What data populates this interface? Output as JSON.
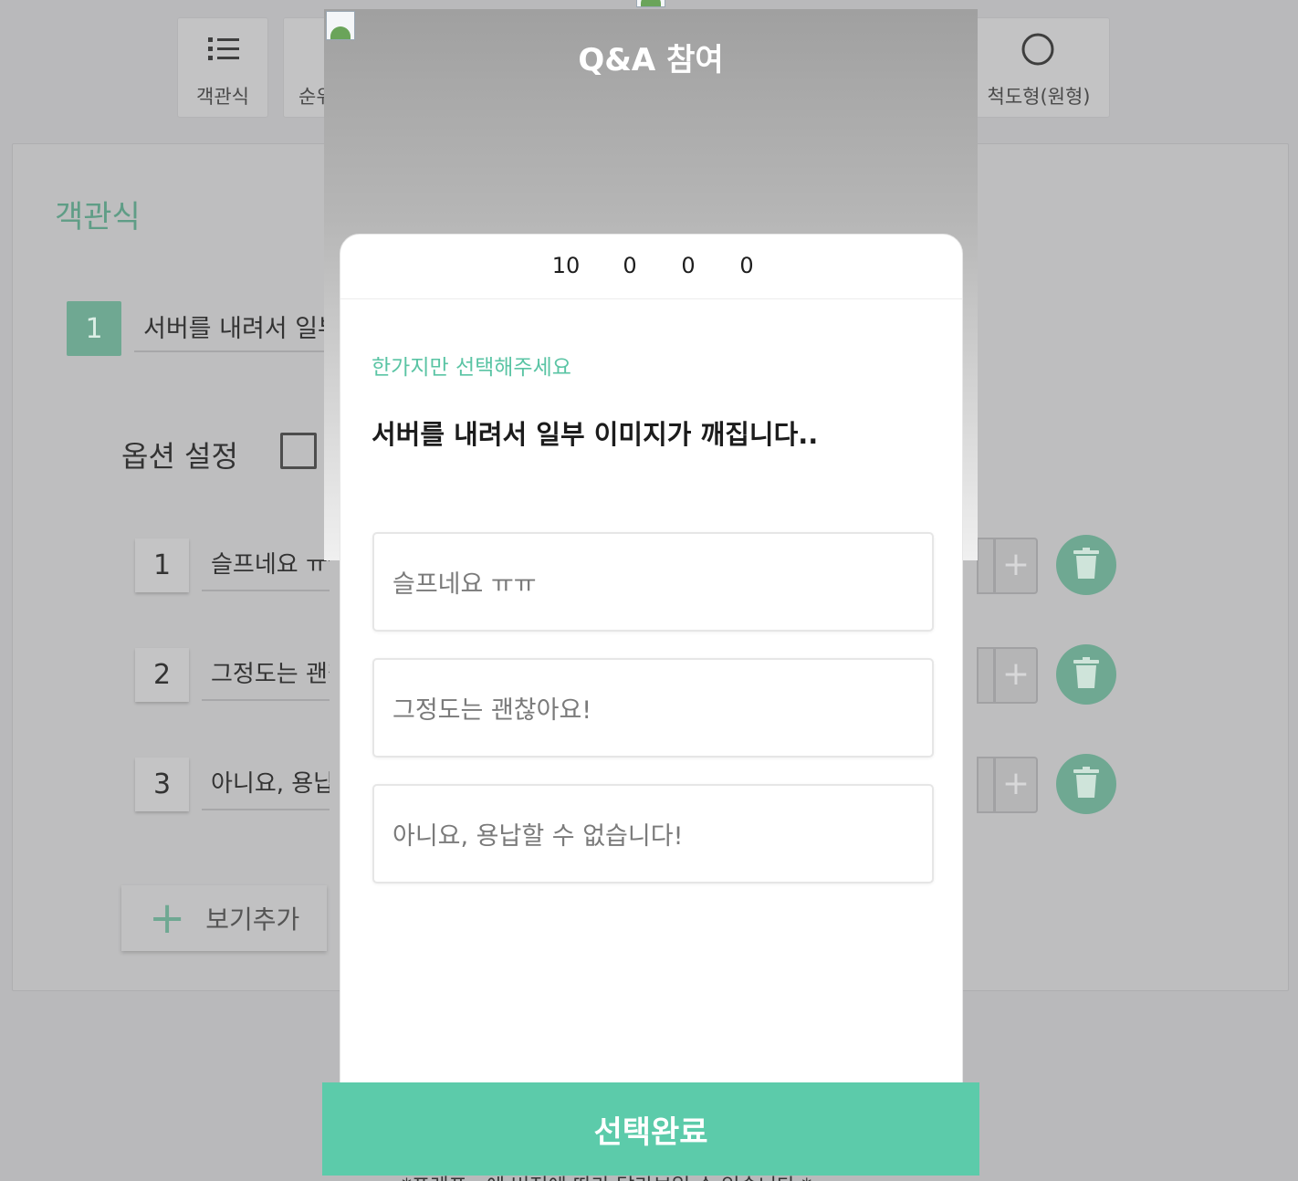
{
  "question_types": [
    {
      "label": "객관식",
      "icon": "list-icon"
    },
    {
      "label": "순위",
      "icon": "rank-icon"
    },
    {
      "label": "척도형(원형)",
      "icon": "circle-icon"
    }
  ],
  "editor": {
    "section_title": "객관식",
    "question_number": "1",
    "question_text": "서버를 내려서 일부 이미지가 깨집니다..",
    "option_settings_label": "옵션 설정",
    "options": [
      {
        "number": "1",
        "text": "슬프네요 ㅠㅠ"
      },
      {
        "number": "2",
        "text": "그정도는 괜찮아요!"
      },
      {
        "number": "3",
        "text": "아니요, 용납할 수 없습니다!"
      }
    ],
    "add_option_label": "보기추가",
    "footer_note": "*프레프 · 에 버전에 따라 달라보일 수 있습니다.*"
  },
  "preview": {
    "title": "Q&A 참여",
    "stats": [
      "10",
      "0",
      "0",
      "0"
    ],
    "instruction": "한가지만 선택해주세요",
    "question": "서버를 내려서 일부 이미지가 깨집니다..",
    "choices": [
      "슬프네요 ㅠㅠ",
      "그정도는 괜찮아요!",
      "아니요, 용납할 수 없습니다!"
    ],
    "submit_label": "선택완료"
  },
  "colors": {
    "accent": "#5ccbaa",
    "accent_dimmed": "#6fa892",
    "overlay_background": "#b9b9bb"
  }
}
